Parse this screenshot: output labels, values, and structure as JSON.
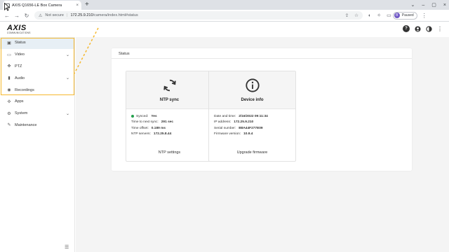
{
  "browser": {
    "tab_title": "AXIS Q1656-LE Box Camera",
    "tab_close": "×",
    "new_tab": "+",
    "window_controls": [
      "⌄",
      "–",
      "▢",
      "×"
    ],
    "nav": {
      "back": "←",
      "forward": "→",
      "reload": "↻"
    },
    "address": {
      "warning_icon": "⚠",
      "security_label": "Not secure",
      "separator": "|",
      "host": "172.25.9.210",
      "path": "/camera/index.html#status"
    },
    "profile": {
      "initial": "B",
      "label": "Paused"
    }
  },
  "app": {
    "logo_text": "AXIS",
    "logo_sub": "COMMUNICATIONS",
    "header_icons": [
      "help-icon",
      "user-icon",
      "contrast-icon",
      "more-icon"
    ]
  },
  "sidebar": {
    "items": [
      {
        "label": "Status",
        "icon": "status-icon",
        "active": true,
        "chevron": false
      },
      {
        "label": "Video",
        "icon": "video-icon",
        "active": false,
        "chevron": true
      },
      {
        "label": "PTZ",
        "icon": "ptz-icon",
        "active": false,
        "chevron": false
      },
      {
        "label": "Audio",
        "icon": "audio-icon",
        "active": false,
        "chevron": true
      },
      {
        "label": "Recordings",
        "icon": "recordings-icon",
        "active": false,
        "chevron": false
      },
      {
        "label": "Apps",
        "icon": "apps-icon",
        "active": false,
        "chevron": false
      },
      {
        "label": "System",
        "icon": "system-icon",
        "active": false,
        "chevron": true
      },
      {
        "label": "Maintenance",
        "icon": "maintenance-icon",
        "active": false,
        "chevron": false
      }
    ],
    "highlight_color": "#f5b82e"
  },
  "status_panel": {
    "title": "Status",
    "ntp": {
      "title": "NTP sync",
      "synced_label": "Synced:",
      "synced_value": "Yes",
      "rows": [
        {
          "label": "Time to next sync:",
          "value": "291 sec"
        },
        {
          "label": "Time offset:",
          "value": "0.189 ms"
        },
        {
          "label": "NTP servers:",
          "value": "172.25.8.44"
        }
      ],
      "action": "NTP settings",
      "status_color": "#23a04c"
    },
    "device": {
      "title": "Device info",
      "rows": [
        {
          "label": "Date and time:",
          "value": "2/16/2022 09:11:34"
        },
        {
          "label": "IP address:",
          "value": "172.25.9.210"
        },
        {
          "label": "Serial number:",
          "value": "B8A44F277E09"
        },
        {
          "label": "Firmware version:",
          "value": "10.9.4"
        }
      ],
      "action": "Upgrade firmware"
    }
  }
}
